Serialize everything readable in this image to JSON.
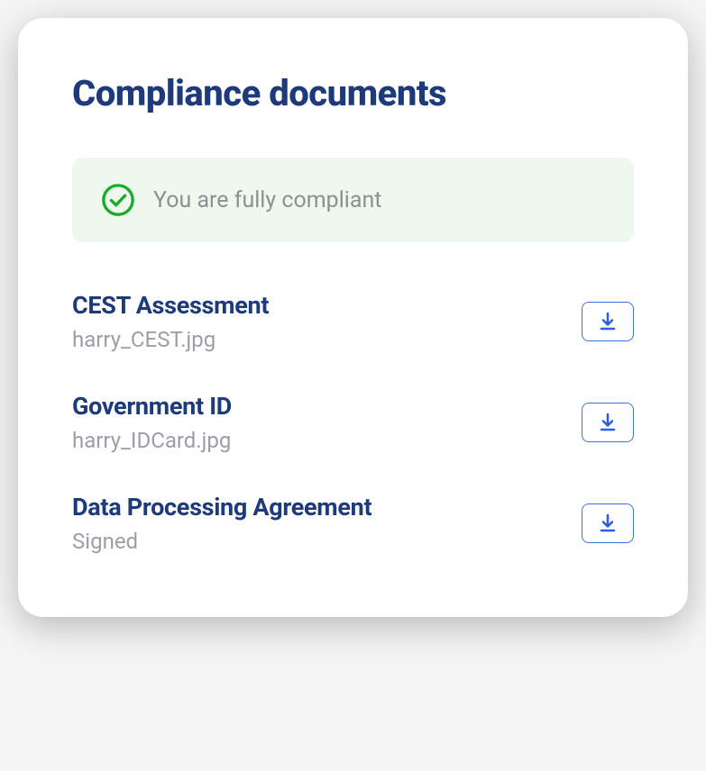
{
  "title": "Compliance documents",
  "status": {
    "text": "You are fully compliant"
  },
  "documents": [
    {
      "title": "CEST Assessment",
      "subtitle": "harry_CEST.jpg"
    },
    {
      "title": "Government ID",
      "subtitle": "harry_IDCard.jpg"
    },
    {
      "title": "Data Processing Agreement",
      "subtitle": "Signed"
    }
  ]
}
